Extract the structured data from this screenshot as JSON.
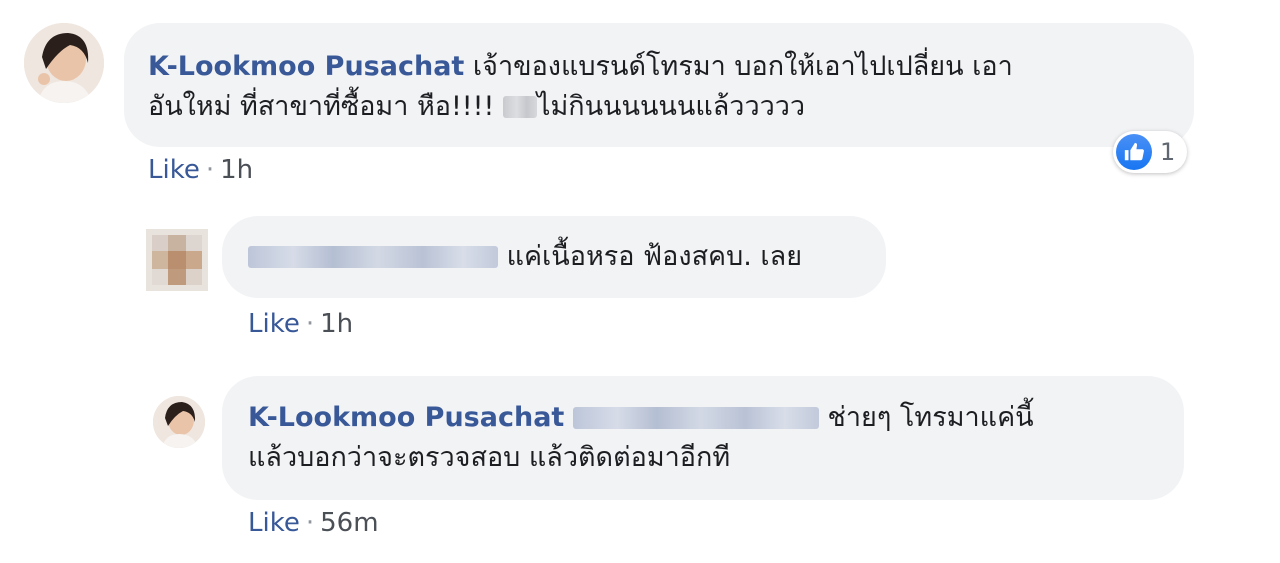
{
  "comments": [
    {
      "author": "K-Lookmoo Pusachat",
      "text_line1": "เจ้าของแบรนด์โทรมา บอกให้เอาไปเปลี่ยน เอา",
      "text_line2_before": "อันใหม่ ที่สาขาที่ซื้อมา หือ!!!!",
      "text_line2_after": "ไม่กินนนนนนแล้ววววว",
      "like_label": "Like",
      "separator": "·",
      "time": "1h",
      "reaction_count": "1"
    },
    {
      "text": "แค่เนื้อหรอ ฟ้องสคบ. เลย",
      "like_label": "Like",
      "separator": "·",
      "time": "1h"
    },
    {
      "author": "K-Lookmoo Pusachat",
      "text_line1": "ช่ายๆ โทรมาแค่นี้",
      "text_line2": "แล้วบอกว่าจะตรวจสอบ แล้วติดต่อมาอีกที",
      "like_label": "Like",
      "separator": "·",
      "time": "56m"
    }
  ],
  "colors": {
    "author": "#385898",
    "bubble": "#f2f3f5",
    "text": "#1c1e21",
    "meta": "#4b4f56",
    "like_reaction": "#1876f2"
  },
  "icons": {
    "reaction": "thumbs-up-icon",
    "avatar_1": "user-avatar",
    "avatar_2": "blurred-avatar",
    "avatar_3": "user-avatar"
  }
}
